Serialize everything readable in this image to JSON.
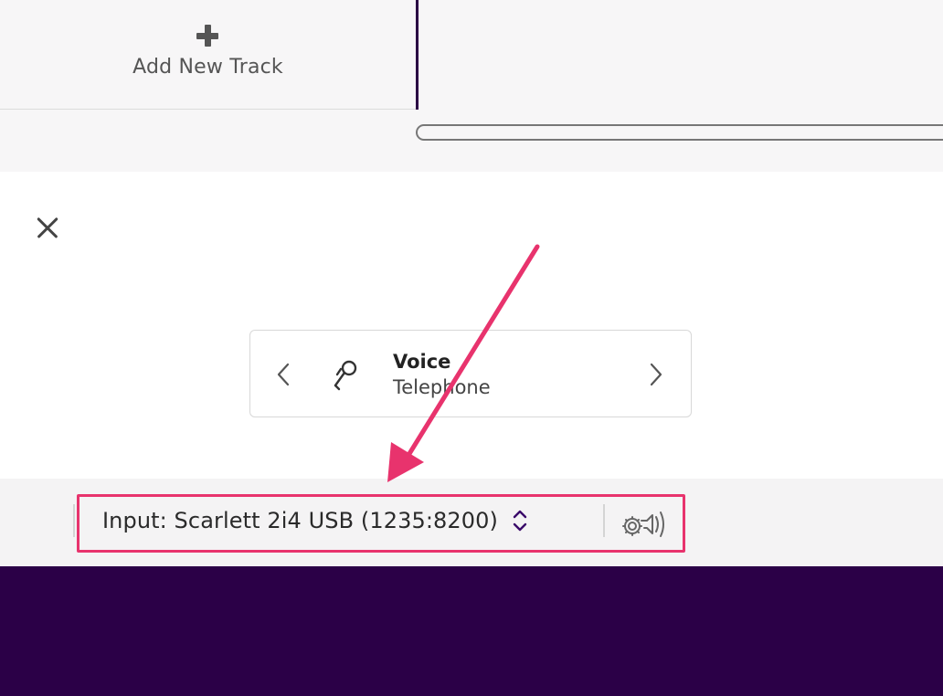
{
  "track_area": {
    "add_track_label": "Add New Track"
  },
  "preset": {
    "name": "Voice",
    "subtitle": "Telephone",
    "icon": "microphone-icon"
  },
  "input_bar": {
    "input_label": "Input: Scarlett 2i4 USB (1235:8200)",
    "settings_icon": "audio-settings-icon"
  },
  "colors": {
    "accent_purple": "#2b0047",
    "annotation_pink": "#e8336d",
    "chevron_purple": "#3a0a6a"
  }
}
